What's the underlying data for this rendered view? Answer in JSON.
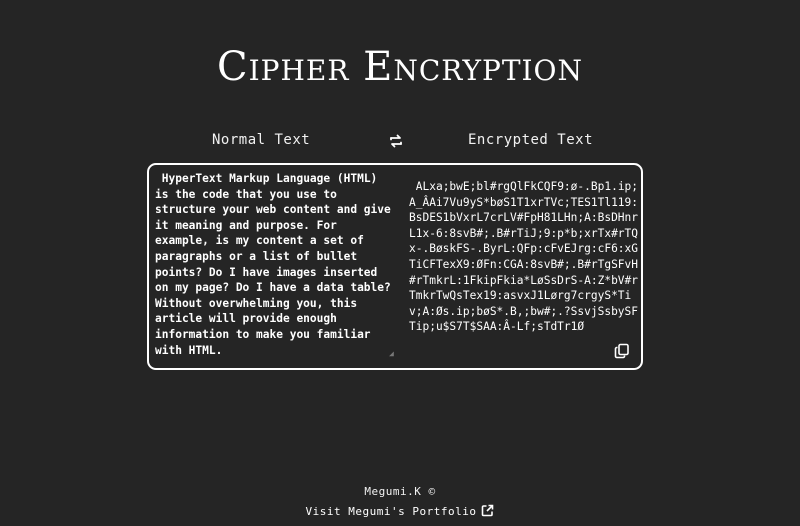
{
  "header": {
    "title": "Cipher Encryption"
  },
  "labels": {
    "normal": "Normal Text",
    "encrypted": "Encrypted Text"
  },
  "input": {
    "value": " HyperText Markup Language (HTML) is the code that you use to structure your web content and give it meaning and purpose. For example, is my content a set of paragraphs or a list of bullet points? Do I have images inserted on my page? Do I have a data table? Without overwhelming you, this article will provide enough information to make you familiar with HTML."
  },
  "output": {
    "value": " ALxa;bwE;bl#rgQlFkCQF9:ø-.Bp1.ip;A_ÂAi7Vu9yS*bøS1T1xrTVc;TES1Tl119:BsDES1bVxrL7crLV#FpH81LHn;A:BsDHnrL1x-6:8svB#;.B#rTiJ;9:p*b;xrTx#rTQx-.BøskFS-.ByrL:QFp:cFvEJrg:cF6:xGTiCFTexX9:ØFn:CGA:8svB#;.B#rTgSFvH#rTmkrL:1FkipFkia*LøSsDrS-A:Z*bV#rTmkrTwQsTex19:asvxJ1Lørg7crgyS*Tiv;A:Øs.ip;bøS*.B,;bw#;.?SsvjSsbySFTip;u$S7T$SAA:Â-Lf;sTdTr1Ø"
  },
  "footer": {
    "author": "Megumi.K ©",
    "link_label": "Visit Megumi's Portfolio"
  },
  "icons": {
    "swap": "swap-arrows-icon",
    "copy": "copy-icon",
    "external": "external-link-icon"
  },
  "colors": {
    "background": "#252525",
    "text": "#ffffff",
    "border": "#ffffff"
  }
}
